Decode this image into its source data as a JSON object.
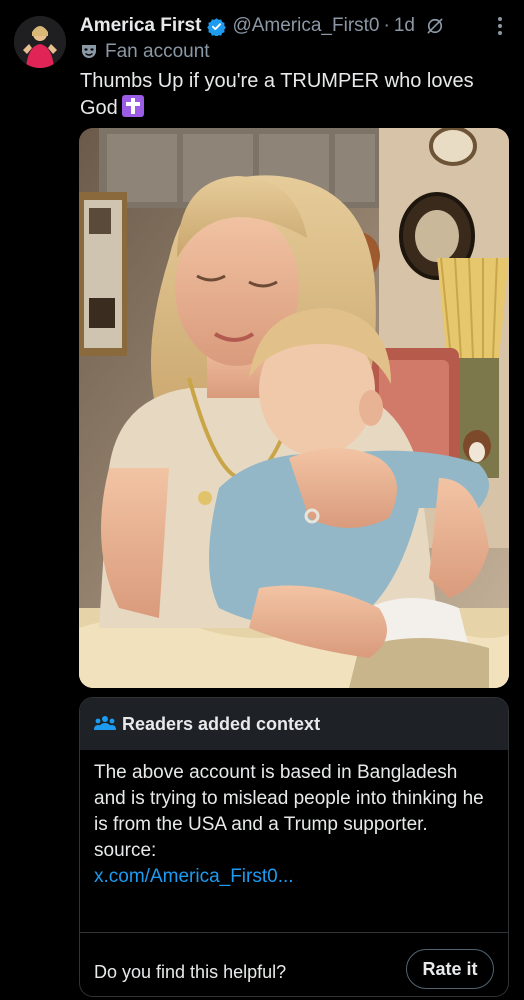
{
  "tweet": {
    "display_name": "America First",
    "handle": "@America_First0",
    "separator": "·",
    "time": "1d",
    "label": "Fan account",
    "text": "Thumbs Up if you're a TRUMPER who loves God",
    "text_emoji": "latin-cross-emoji"
  },
  "community_note": {
    "title": "Readers added context",
    "body": "The above account is based in Bangladesh and is trying to mislead people into thinking he is from the USA and a Trump supporter.",
    "source_label": "source:",
    "source_link": "x.com/America_First0...",
    "helpful_prompt": "Do you find this helpful?",
    "rate_label": "Rate it"
  },
  "icons": {
    "verified": "verified-badge-icon",
    "grok": "grok-icon",
    "more": "more-options-icon",
    "fan": "theater-mask-icon",
    "note": "people-icon"
  },
  "colors": {
    "background": "#000000",
    "text": "#e7e9ea",
    "muted": "#8b98a5",
    "link": "#1d9bf0",
    "verified": "#1d9bf0",
    "note_header": "#1e2126",
    "border": "#2f3336"
  }
}
